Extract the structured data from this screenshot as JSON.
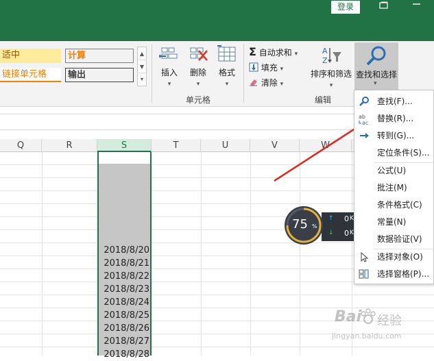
{
  "titlebar": {
    "login_label": "登录",
    "restore_icon": "restore-window-icon",
    "minimize_icon": "minimize-icon"
  },
  "cell_styles": [
    {
      "label": "适中",
      "bg": "#ffeb9c",
      "color": "#9c5700"
    },
    {
      "label": "计算",
      "bg": "#f2f2f2",
      "color": "#fa7d00"
    },
    {
      "label": "链接单元格",
      "bg": "#ffffff",
      "color": "#fa7d00"
    },
    {
      "label": "输出",
      "bg": "#f2f2f2",
      "color": "#3f3f3f"
    }
  ],
  "ribbon": {
    "cells_group": {
      "label": "单元格",
      "insert": "插入",
      "delete": "删除",
      "format": "格式"
    },
    "edit_group": {
      "label": "编辑",
      "autosum": "自动求和",
      "fill": "填充",
      "clear": "清除",
      "sort_filter": "排序和筛选",
      "find_select": "查找和选择"
    }
  },
  "columns": [
    {
      "name": "Q"
    },
    {
      "name": "R"
    },
    {
      "name": "S",
      "selected": true
    },
    {
      "name": "T"
    },
    {
      "name": "U"
    },
    {
      "name": "V"
    },
    {
      "name": "W"
    }
  ],
  "dates": [
    "2018/8/20",
    "2018/8/21",
    "2018/8/22",
    "2018/8/23",
    "2018/8/24",
    "2018/8/25",
    "2018/8/26",
    "2018/8/27",
    "2018/8/28"
  ],
  "menu": {
    "items": [
      {
        "label": "查找(F)...",
        "icon": "find-icon"
      },
      {
        "label": "替换(R)...",
        "icon": "replace-icon"
      },
      {
        "label": "转到(G)...",
        "icon": "goto-arrow-icon"
      },
      {
        "label": "定位条件(S)...",
        "icon": ""
      },
      {
        "label": "公式(U)",
        "icon": ""
      },
      {
        "label": "批注(M)",
        "icon": ""
      },
      {
        "label": "条件格式(C)",
        "icon": ""
      },
      {
        "label": "常量(N)",
        "icon": ""
      },
      {
        "label": "数据验证(V)",
        "icon": ""
      },
      {
        "label": "选择对象(O)",
        "icon": "select-objects-icon"
      },
      {
        "label": "选择窗格(P)...",
        "icon": "selection-pane-icon"
      }
    ]
  },
  "speed_widget": {
    "percent": "75",
    "percent_sign": "%",
    "up_value": "0",
    "down_value": "0",
    "up_unit": "K",
    "down_unit": "K"
  },
  "watermark": {
    "brand": "Bai",
    "brand_suffix": "经验",
    "url": "jingyan.baidu.com"
  },
  "colors": {
    "excel_green": "#217346",
    "arrow_red": "#e8211d",
    "selected_fill": "#c6c6c6"
  }
}
